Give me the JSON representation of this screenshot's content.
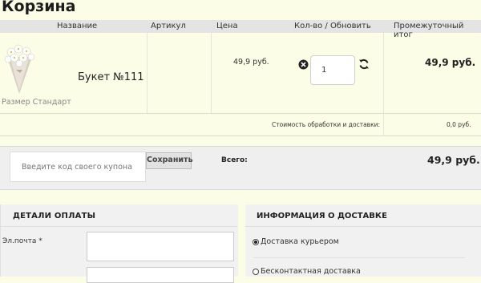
{
  "page": {
    "title": "Корзина"
  },
  "table": {
    "headers": [
      "Название",
      "Артикул",
      "Цена",
      "Кол-во / Обновить",
      "Промежуточный итог"
    ]
  },
  "item": {
    "name": "Букет №111",
    "size": "Размер Стандарт",
    "article": "",
    "price": "49,9 руб.",
    "quantity": "1",
    "subtotal": "49,9 руб."
  },
  "shipping": {
    "label": "Стоимость обработки и доставки:",
    "value": "0,0 руб."
  },
  "coupon": {
    "placeholder": "Введите код своего купона",
    "button": "Сохранить"
  },
  "total": {
    "label": "Всего:",
    "value": "49,9 руб."
  },
  "payment": {
    "title": "ДЕТАЛИ ОПЛАТЫ",
    "email_label": "Эл.почта *"
  },
  "delivery": {
    "title": "ИНФОРМАЦИЯ О ДОСТАВКЕ",
    "options": [
      "Доставка курьером",
      "Бесконтактная доставка"
    ],
    "selected": 0
  },
  "colors": {
    "background": "#fbfde6",
    "header_band": "#e4e4e4",
    "panel": "#f1f1f1"
  }
}
